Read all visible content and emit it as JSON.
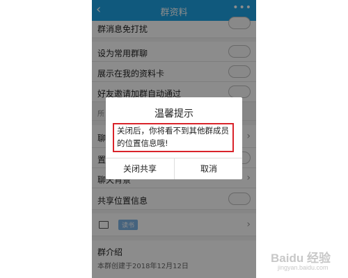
{
  "header": {
    "title": "群资料",
    "back_icon": "‹",
    "more_icon": "•••"
  },
  "rows": [
    {
      "label": "群消息免打扰"
    },
    {
      "label": "设为常用群聊"
    },
    {
      "label": "展示在我的资料卡"
    },
    {
      "label": "好友邀请加群自动通过"
    },
    {
      "label": "所"
    },
    {
      "label": "聊"
    },
    {
      "label": "置"
    },
    {
      "label": "聊天背景"
    },
    {
      "label": "共享位置信息"
    },
    {
      "label": "读书"
    },
    {
      "label": "群介绍",
      "sub": "本群创建于2018年12月12日"
    }
  ],
  "dialog": {
    "title": "温馨提示",
    "message": "关闭后，你将看不到其他群成员的位置信息哦!",
    "confirm_label": "关闭共享",
    "cancel_label": "取消",
    "highlight_color": "#d9232a"
  },
  "watermark": {
    "main": "Baidu 经验",
    "sub": "jingyan.baidu.com"
  },
  "colors": {
    "header": "#1ea3e4"
  }
}
